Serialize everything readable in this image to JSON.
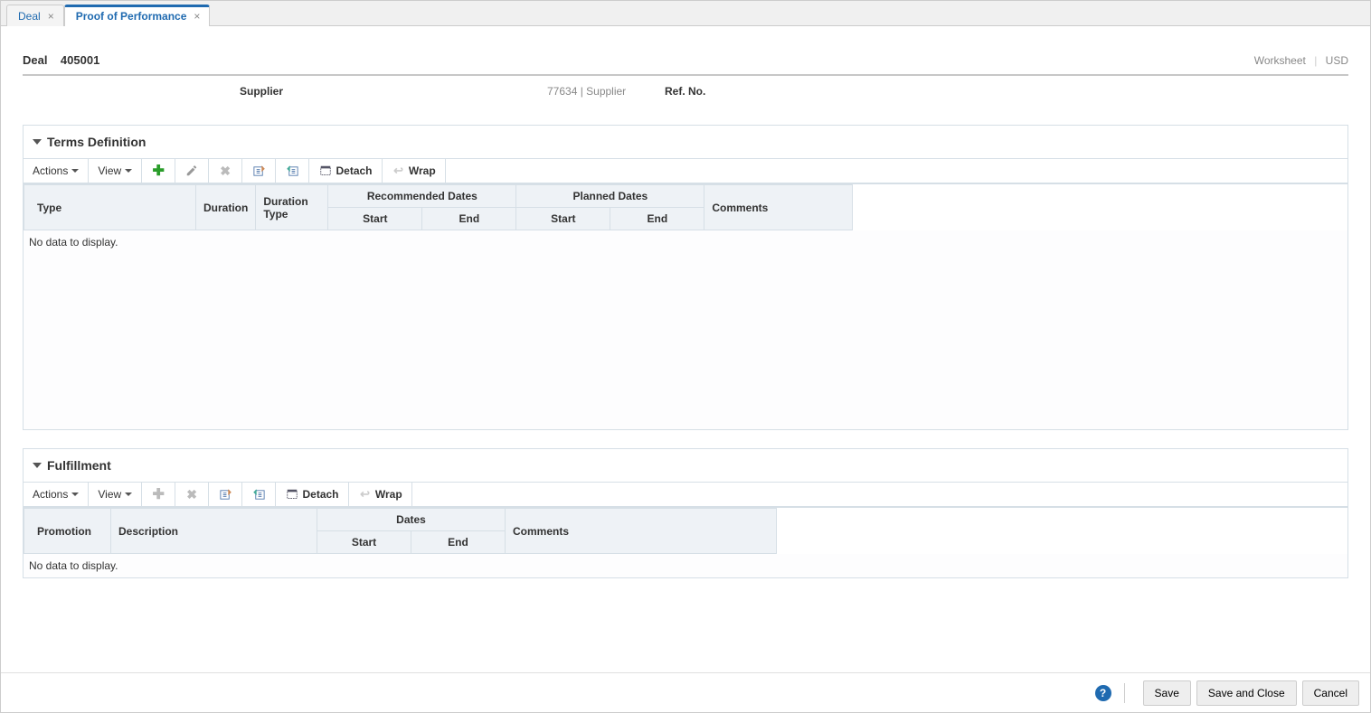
{
  "tabs": [
    {
      "label": "Deal",
      "active": false
    },
    {
      "label": "Proof of Performance",
      "active": true
    }
  ],
  "header": {
    "deal_label": "Deal",
    "deal_number": "405001",
    "worksheet_link": "Worksheet",
    "currency": "USD"
  },
  "supplier_row": {
    "supplier_label": "Supplier",
    "supplier_value": "77634 | Supplier",
    "ref_label": "Ref. No."
  },
  "terms_panel": {
    "title": "Terms Definition",
    "toolbar": {
      "actions": "Actions",
      "view": "View",
      "detach": "Detach",
      "wrap": "Wrap"
    },
    "columns": {
      "type": "Type",
      "duration": "Duration",
      "duration_type": "Duration Type",
      "recommended_dates": "Recommended Dates",
      "planned_dates": "Planned Dates",
      "start": "Start",
      "end": "End",
      "comments": "Comments"
    },
    "empty_message": "No data to display."
  },
  "fulfillment_panel": {
    "title": "Fulfillment",
    "toolbar": {
      "actions": "Actions",
      "view": "View",
      "detach": "Detach",
      "wrap": "Wrap"
    },
    "columns": {
      "promotion": "Promotion",
      "description": "Description",
      "dates": "Dates",
      "start": "Start",
      "end": "End",
      "comments": "Comments"
    },
    "empty_message": "No data to display."
  },
  "footer": {
    "save": "Save",
    "save_and_close": "Save and Close",
    "cancel": "Cancel"
  }
}
